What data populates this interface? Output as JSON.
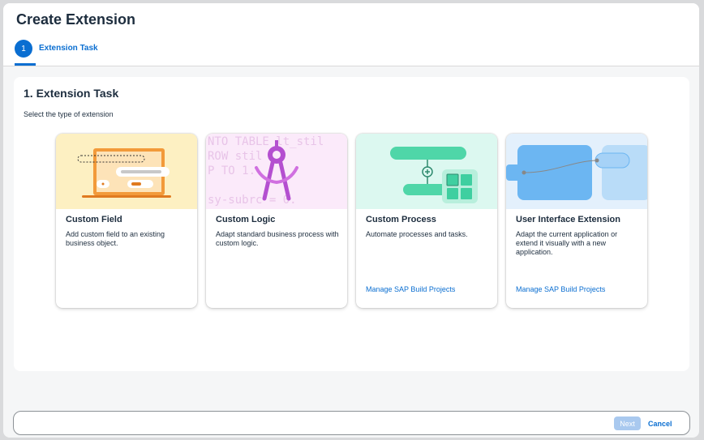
{
  "dialog": {
    "title": "Create Extension",
    "step": {
      "number": "1",
      "label": "Extension Task"
    }
  },
  "main": {
    "section_title": "1. Extension Task",
    "section_subtitle": "Select the type of extension",
    "cards": [
      {
        "title": "Custom Field",
        "description": "Add custom field to an existing business object.",
        "link": "",
        "icon": "laptop-form-illustration",
        "color": "#fdf0c2"
      },
      {
        "title": "Custom Logic",
        "description": "Adapt standard business process with custom logic.",
        "link": "",
        "icon": "compass-illustration",
        "color": "#fbeafa"
      },
      {
        "title": "Custom Process",
        "description": "Automate processes and tasks.",
        "link": "Manage SAP Build Projects",
        "icon": "process-flow-illustration",
        "color": "#dcf8f0"
      },
      {
        "title": "User Interface Extension",
        "description": "Adapt the current application or extend it visually with a new application.",
        "link": "Manage SAP Build Projects",
        "icon": "ui-connect-illustration",
        "color": "#e3f0fc"
      }
    ],
    "code_snippet": [
      "NTO TABLE lt_stil",
      "ROW stil",
      "P TO 1.",
      "sy-subrc = 0."
    ]
  },
  "footer": {
    "next_label": "Next",
    "cancel_label": "Cancel"
  },
  "colors": {
    "accent": "#0a6ed1",
    "disabled_button": "#a9c9ef"
  }
}
